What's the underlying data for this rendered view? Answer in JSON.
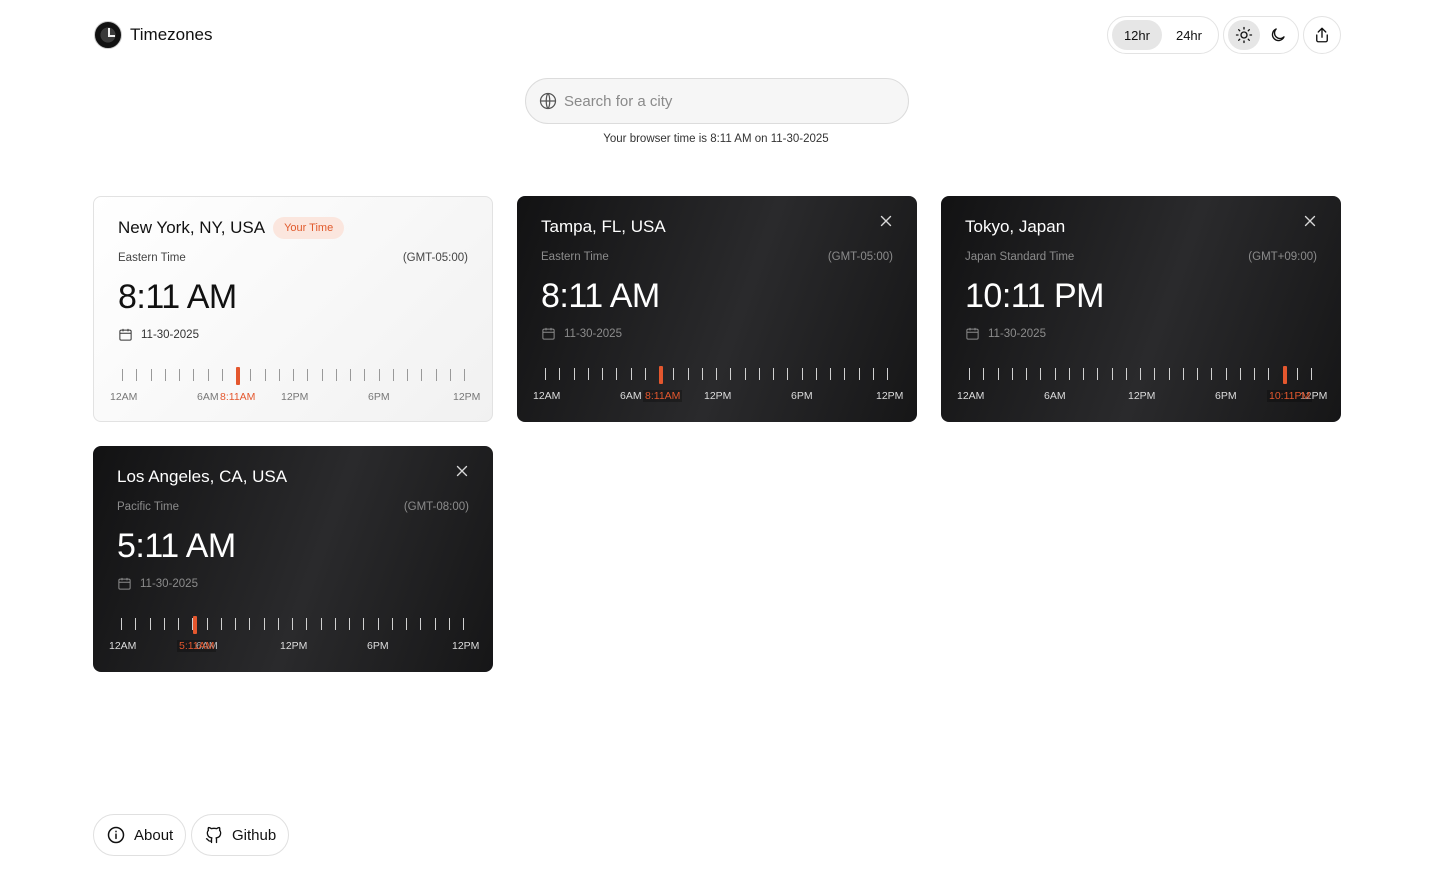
{
  "app": {
    "name": "Timezones"
  },
  "controls": {
    "format_12": "12hr",
    "format_24": "24hr"
  },
  "search": {
    "placeholder": "Search for a city"
  },
  "browser_time": "Your browser time is 8:11 AM on 11-30-2025",
  "cards": [
    {
      "theme": "light",
      "city": "New York, NY, USA",
      "badge": "Your Time",
      "zone_name": "Eastern Time",
      "offset": "(GMT-05:00)",
      "time": "8:11 AM",
      "date": "11-30-2025",
      "now_label": "8:11AM",
      "now_fraction": 0.34
    },
    {
      "theme": "dark",
      "city": "Tampa, FL, USA",
      "zone_name": "Eastern Time",
      "offset": "(GMT-05:00)",
      "time": "8:11 AM",
      "date": "11-30-2025",
      "now_label": "8:11AM",
      "now_fraction": 0.34
    },
    {
      "theme": "dark",
      "city": "Tokyo, Japan",
      "zone_name": "Japan Standard Time",
      "offset": "(GMT+09:00)",
      "time": "10:11 PM",
      "date": "11-30-2025",
      "now_label": "10:11PM",
      "now_fraction": 0.925
    },
    {
      "theme": "dark",
      "city": "Los Angeles, CA, USA",
      "zone_name": "Pacific Time",
      "offset": "(GMT-08:00)",
      "time": "5:11 AM",
      "date": "11-30-2025",
      "now_label": "5:11AM",
      "now_fraction": 0.215
    }
  ],
  "axis_labels": [
    "12AM",
    "6AM",
    "12PM",
    "6PM",
    "12PM"
  ],
  "footer": {
    "about": "About",
    "github": "Github"
  },
  "colors": {
    "accent": "#e4572e",
    "badge_bg": "#fbe6de",
    "dark_card": "#1b1b1c"
  }
}
